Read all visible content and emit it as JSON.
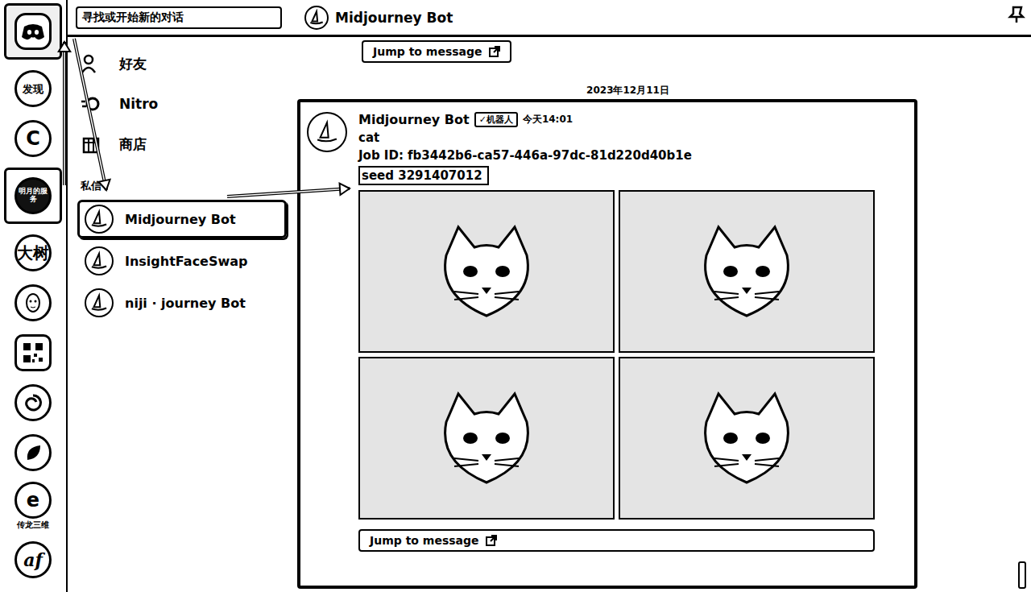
{
  "search": {
    "placeholder": "寻找或开始新的对话"
  },
  "header": {
    "title": "Midjourney Bot"
  },
  "servers": [
    {
      "kind": "discord",
      "label": "",
      "caption": "",
      "selected": true,
      "boxed": true
    },
    {
      "kind": "text",
      "label": "发现",
      "caption": "",
      "selected": false,
      "boxed": false
    },
    {
      "kind": "letter",
      "label": "C",
      "caption": "",
      "selected": false,
      "boxed": false
    },
    {
      "kind": "dark",
      "label": "明月的服务",
      "caption": "",
      "selected": false,
      "boxed": true
    },
    {
      "kind": "text",
      "label": "大树",
      "caption": "",
      "selected": false,
      "boxed": false
    },
    {
      "kind": "face",
      "label": "",
      "caption": "",
      "selected": false,
      "boxed": false
    },
    {
      "kind": "qr",
      "label": "",
      "caption": "",
      "selected": false,
      "boxed": false
    },
    {
      "kind": "swirl",
      "label": "",
      "caption": "",
      "selected": false,
      "boxed": false
    },
    {
      "kind": "leaf",
      "label": "",
      "caption": "",
      "selected": false,
      "boxed": false
    },
    {
      "kind": "letter",
      "label": "e",
      "caption": "传龙三维",
      "selected": false,
      "boxed": false
    },
    {
      "kind": "script",
      "label": "af",
      "caption": "",
      "selected": false,
      "boxed": false
    }
  ],
  "nav": [
    {
      "label": "好友",
      "kind": "friends"
    },
    {
      "label": "Nitro",
      "kind": "nitro"
    },
    {
      "label": "商店",
      "kind": "shop"
    }
  ],
  "dm_section": "私信",
  "dms": [
    {
      "name": "Midjourney Bot",
      "selected": true
    },
    {
      "name": "InsightFaceSwap",
      "selected": false
    },
    {
      "name": "niji · journey Bot",
      "selected": false
    }
  ],
  "chat": {
    "jump_top": "Jump to message",
    "date": "2023年12月11日",
    "message": {
      "author": "Midjourney Bot",
      "badge": "✓机器人",
      "time": "今天14:01",
      "prompt": "cat",
      "job_id": "Job ID: fb3442b6-ca57-446a-97dc-81d220d40b1e",
      "seed": "seed 3291407012"
    },
    "jump_bottom": "Jump to message"
  }
}
